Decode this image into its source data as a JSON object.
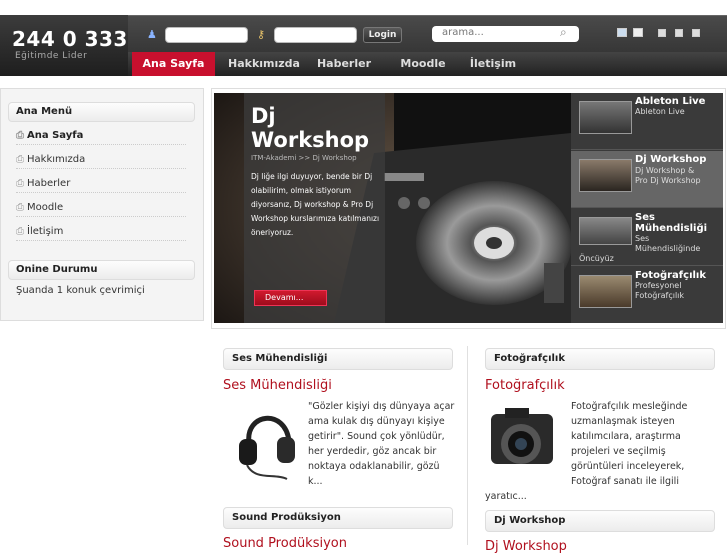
{
  "header": {
    "phone": "244 0 333",
    "tagline": "Eğitimde Lider",
    "login_label": "Login",
    "search_placeholder": "arama..."
  },
  "nav": {
    "items": [
      "Ana Sayfa",
      "Hakkımızda",
      "Haberler",
      "Moodle",
      "İletişim"
    ]
  },
  "sidebar": {
    "menu_title": "Ana Menü",
    "menu_items": [
      "Ana Sayfa",
      "Hakkımızda",
      "Haberler",
      "Moodle",
      "İletişim"
    ],
    "online_title": "Onine Durumu",
    "online_text": "Şuanda 1 konuk çevrimiçi"
  },
  "slider": {
    "title_line1": "Dj",
    "title_line2": "Workshop",
    "breadcrumb": "ITM-Akademi >> Dj Workshop",
    "description": "Dj liğe ilgi duyuyor, bende bir Dj olabilirim, olmak istiyorum diyorsanız, Dj workshop & Pro Dj Workshop kurslarımıza katılmanızı öneriyoruz.",
    "button": "Devamı...",
    "thumbs": [
      {
        "title": "Ableton Live",
        "sub1": "Ableton Live",
        "sub2": "",
        "sub3": ""
      },
      {
        "title": "Dj Workshop",
        "sub1": "Dj Workshop &",
        "sub2": "Pro Dj Workshop",
        "sub3": ""
      },
      {
        "title": "Ses",
        "title2": "Mühendisliği",
        "sub1": "Ses",
        "sub2": "Mühendisliğinde",
        "sub3": "Öncüyüz"
      },
      {
        "title": "Fotoğrafçılık",
        "sub1": "Profesyonel",
        "sub2": "Fotoğrafçılık",
        "sub3": ""
      }
    ]
  },
  "left_box": {
    "header": "Ses Mühendisliği",
    "title": "Ses Mühendisliği",
    "text": "\"Gözler kişiyi dış dünyaya açar ama kulak dış dünyayı kişiye getirir\". Sound çok yönlüdür, her yerdedir, göz ancak bir noktaya odaklanabilir, gözü k...",
    "header2": "Sound Prodüksiyon",
    "title2": "Sound Prodüksiyon"
  },
  "right_box": {
    "header": "Fotoğrafçılık",
    "title": "Fotoğrafçılık",
    "text": "Fotoğrafçılık mesleğinde uzmanlaşmak isteyen katılımcılara, araştırma projeleri ve seçilmiş görüntüleri inceleyerek, Fotoğraf sanatı ile ilgili yaratıc...",
    "header2": "Dj Workshop",
    "title2": "Dj Workshop"
  },
  "colors": {
    "accent": "#c8102e",
    "link": "#b0101e",
    "bar": "#333333"
  }
}
